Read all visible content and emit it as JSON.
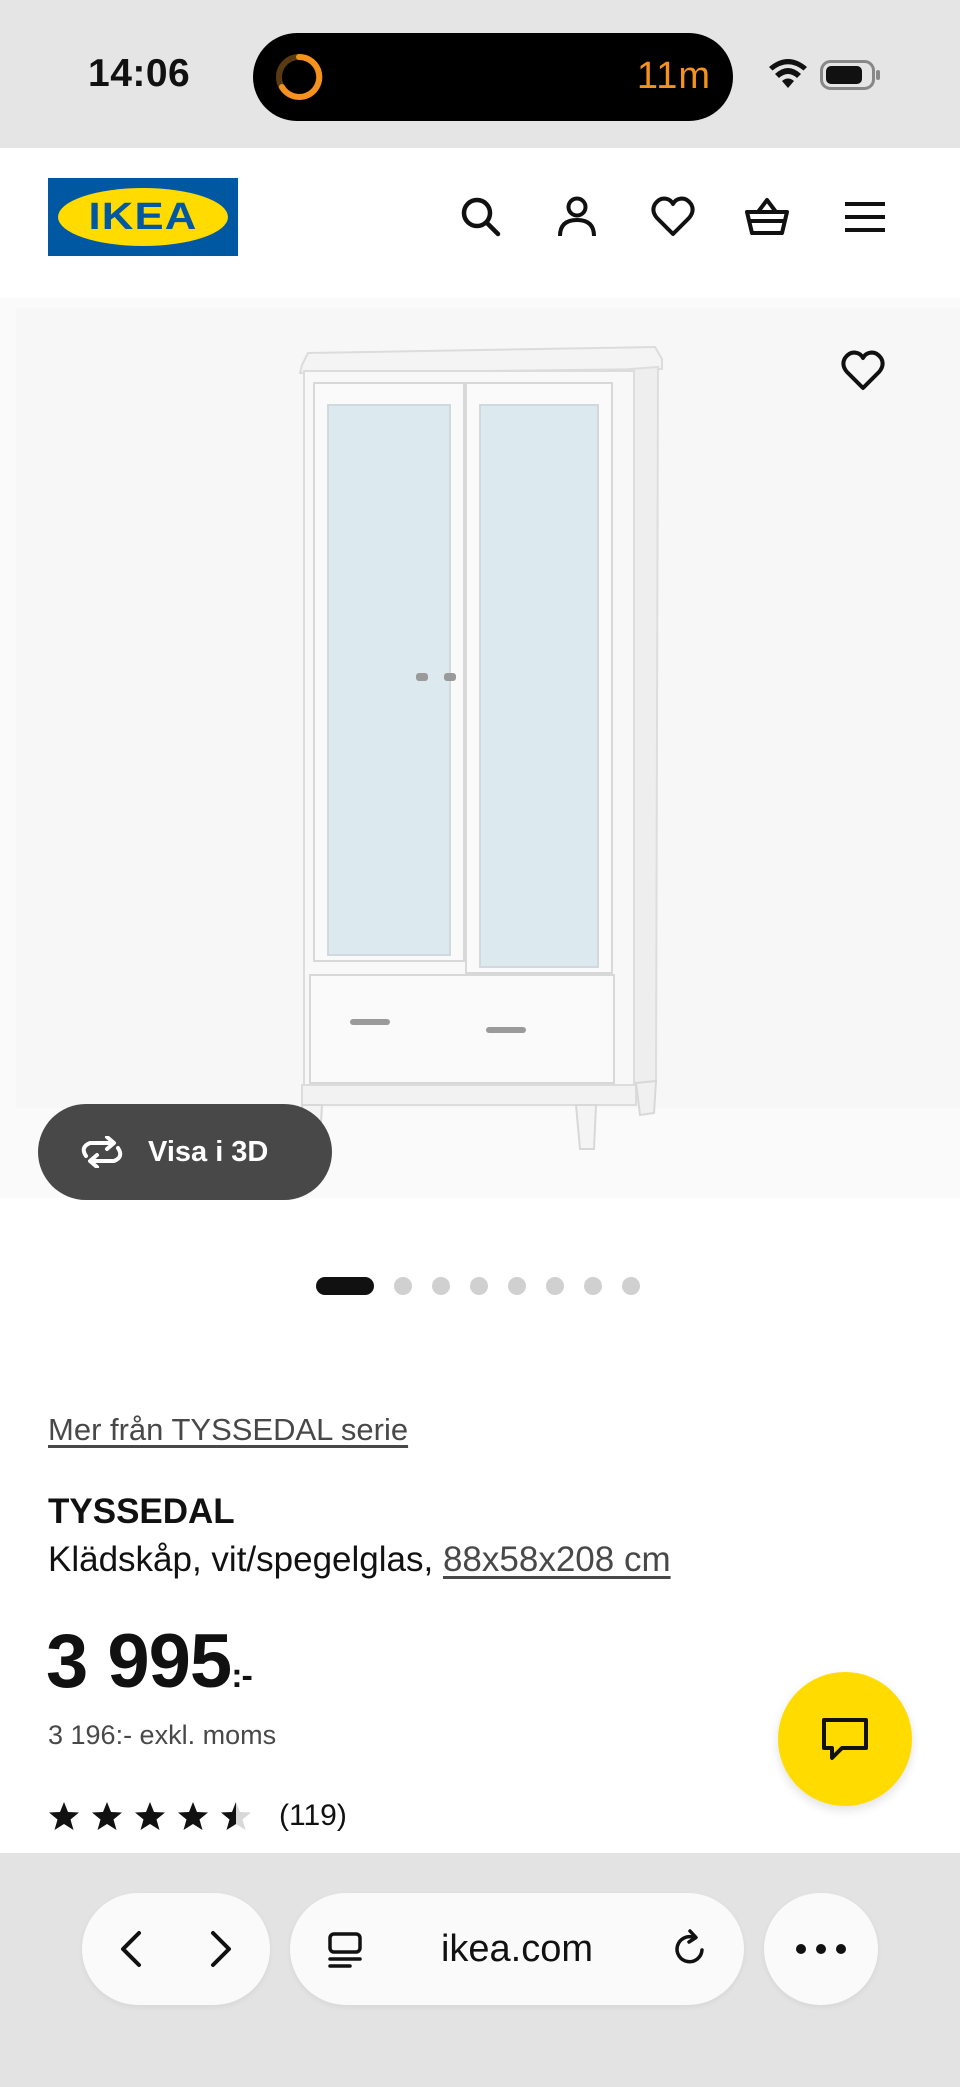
{
  "status_bar": {
    "time": "14:06",
    "timer": "11m",
    "timer_color": "#f5921e"
  },
  "header": {
    "logo_text": "IKEA",
    "brand_blue": "#0058a3",
    "brand_yellow": "#ffdb00",
    "icons": [
      "search-icon",
      "account-icon",
      "heart-icon",
      "basket-icon",
      "menu-icon"
    ]
  },
  "gallery": {
    "view_3d_label": "Visa i 3D",
    "dot_count": 8,
    "active_index": 0
  },
  "product": {
    "series_link": "Mer från TYSSEDAL serie",
    "name": "TYSSEDAL",
    "description": "Klädskåp, vit/spegelglas,",
    "size_link": "88x58x208 cm",
    "price": "3 995",
    "price_suffix": ":-",
    "price_ex_vat": "3 196:- exkl. moms",
    "rating": 4.5,
    "rating_count": "(119)"
  },
  "browser": {
    "url": "ikea.com",
    "icons": [
      "back-icon",
      "forward-icon",
      "tabs-icon",
      "reload-icon",
      "more-icon"
    ]
  }
}
